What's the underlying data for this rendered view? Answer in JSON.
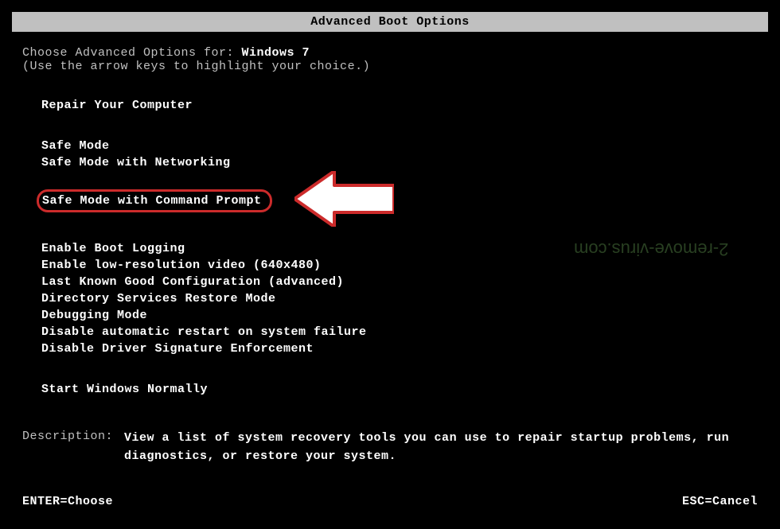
{
  "title": "Advanced Boot Options",
  "prompt": {
    "choose_label": "Choose Advanced Options for: ",
    "os_name": "Windows 7",
    "hint": "(Use the arrow keys to highlight your choice.)"
  },
  "options": {
    "repair": "Repair Your Computer",
    "safe_mode": "Safe Mode",
    "safe_mode_networking": "Safe Mode with Networking",
    "safe_mode_cmd": "Safe Mode with Command Prompt",
    "boot_logging": "Enable Boot Logging",
    "low_res": "Enable low-resolution video (640x480)",
    "last_known": "Last Known Good Configuration (advanced)",
    "ds_restore": "Directory Services Restore Mode",
    "debugging": "Debugging Mode",
    "disable_restart": "Disable automatic restart on system failure",
    "disable_driver_sig": "Disable Driver Signature Enforcement",
    "start_normally": "Start Windows Normally"
  },
  "description": {
    "label": "Description:",
    "text": "View a list of system recovery tools you can use to repair startup problems, run diagnostics, or restore your system."
  },
  "footer": {
    "enter": "ENTER=Choose",
    "esc": "ESC=Cancel"
  },
  "watermark": "2-remove-virus.com",
  "highlight_color": "#cc2b2b"
}
